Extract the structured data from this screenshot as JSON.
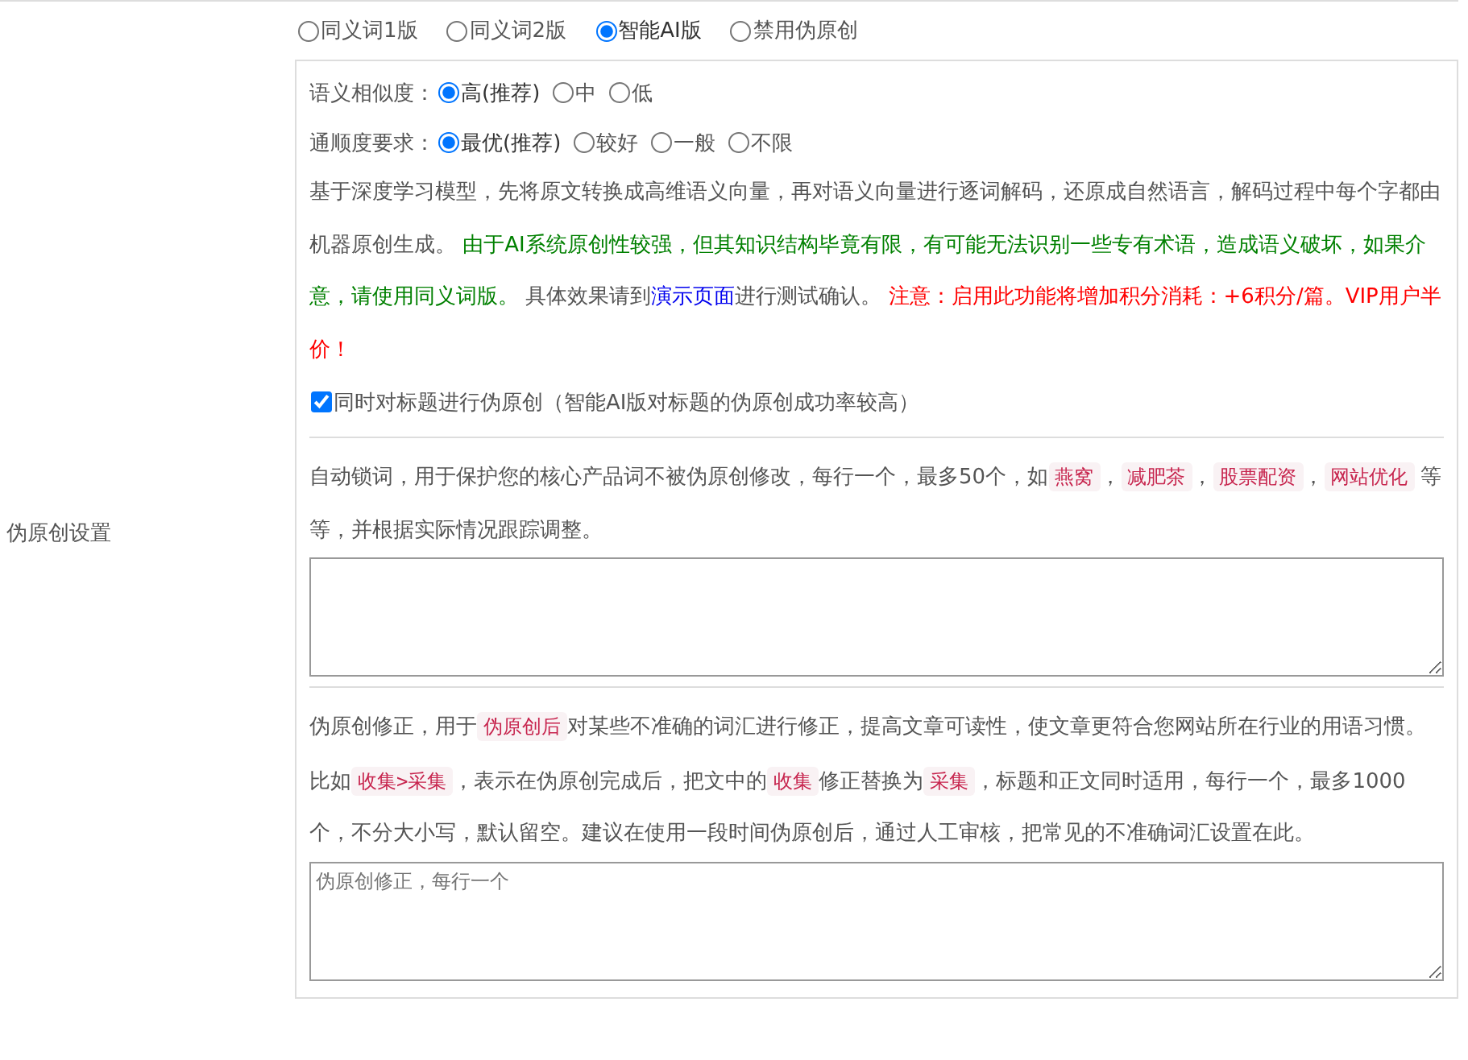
{
  "mode_options": [
    {
      "label": "同义词1版",
      "selected": false
    },
    {
      "label": "同义词2版",
      "selected": false
    },
    {
      "label": "智能AI版",
      "selected": true
    },
    {
      "label": "禁用伪原创",
      "selected": false
    }
  ],
  "section_label": "伪原创设置",
  "similarity": {
    "label": "语义相似度：",
    "options": [
      {
        "label": "高(推荐)",
        "selected": true
      },
      {
        "label": "中",
        "selected": false
      },
      {
        "label": "低",
        "selected": false
      }
    ]
  },
  "fluency": {
    "label": "通顺度要求：",
    "options": [
      {
        "label": "最优(推荐)",
        "selected": true
      },
      {
        "label": "较好",
        "selected": false
      },
      {
        "label": "一般",
        "selected": false
      },
      {
        "label": "不限",
        "selected": false
      }
    ]
  },
  "ai_description": [
    {
      "kind": "text",
      "text": "基于深度学习模型，先将原文转换成高维语义向量，再对语义向量进行逐词解码，还原成自然语言，解码过程中每个字都由机器原创生成。 "
    },
    {
      "kind": "note",
      "text": "由于AI系统原创性较强，但其知识结构毕竟有限，有可能无法识别一些专有术语，造成语义破坏，如果介意，请使用同义词版。"
    },
    {
      "kind": "text",
      "text": " 具体效果请到"
    },
    {
      "kind": "link",
      "text": "演示页面"
    },
    {
      "kind": "text",
      "text": "进行测试确认。 "
    },
    {
      "kind": "warning",
      "text": "注意：启用此功能将增加积分消耗：+6积分/篇。VIP用户半价！"
    }
  ],
  "title_rewrite": {
    "label": "同时对标题进行伪原创（智能AI版对标题的伪原创成功率较高）",
    "checked": true
  },
  "lock_words": {
    "description": [
      {
        "kind": "text",
        "text": "自动锁词，用于保护您的核心产品词不被伪原创修改，每行一个，最多50个，如"
      },
      {
        "kind": "tag",
        "text": "燕窝"
      },
      {
        "kind": "text",
        "text": "，"
      },
      {
        "kind": "tag",
        "text": "减肥茶"
      },
      {
        "kind": "text",
        "text": "，"
      },
      {
        "kind": "tag",
        "text": "股票配资"
      },
      {
        "kind": "text",
        "text": "，"
      },
      {
        "kind": "tag",
        "text": "网站优化"
      },
      {
        "kind": "text",
        "text": " 等等，并根据实际情况跟踪调整。"
      }
    ]
  },
  "correction": {
    "description": [
      {
        "kind": "text",
        "text": "伪原创修正，用于"
      },
      {
        "kind": "tag",
        "text": "伪原创后"
      },
      {
        "kind": "text",
        "text": "对某些不准确的词汇进行修正，提高文章可读性，使文章更符合您网站所在行业的用语习惯。比如"
      },
      {
        "kind": "tag",
        "text": "收集>采集"
      },
      {
        "kind": "text",
        "text": "，表示在伪原创完成后，把文中的"
      },
      {
        "kind": "tag",
        "text": "收集"
      },
      {
        "kind": "text",
        "text": "修正替换为"
      },
      {
        "kind": "tag",
        "text": "采集"
      },
      {
        "kind": "text",
        "text": "，标题和正文同时适用，每行一个，最多1000个，不分大小写，默认留空。建议在使用一段时间伪原创后，通过人工审核，把常见的不准确词汇设置在此。"
      }
    ],
    "placeholder": "伪原创修正，每行一个"
  }
}
